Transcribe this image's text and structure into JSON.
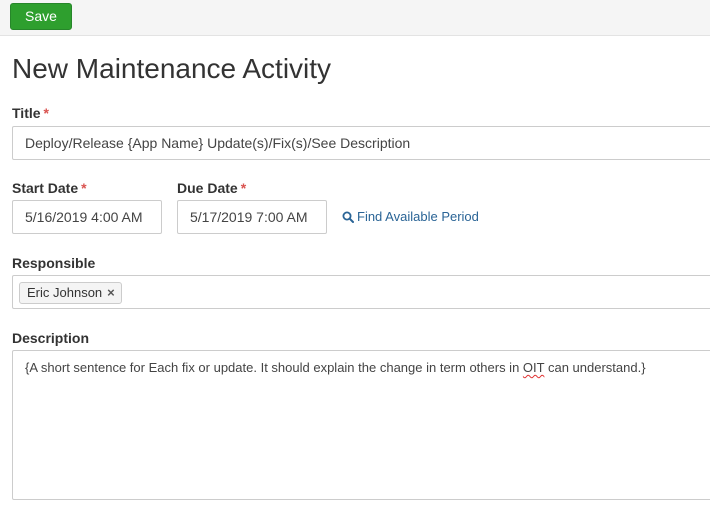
{
  "toolbar": {
    "save_label": "Save"
  },
  "page": {
    "title": "New Maintenance Activity"
  },
  "form": {
    "title": {
      "label": "Title",
      "required_mark": "*",
      "value": "Deploy/Release {App Name} Update(s)/Fix(s)/See Description"
    },
    "start_date": {
      "label": "Start Date",
      "required_mark": "*",
      "value": "5/16/2019 4:00 AM"
    },
    "due_date": {
      "label": "Due Date",
      "required_mark": "*",
      "value": "5/17/2019 7:00 AM"
    },
    "find_period": {
      "label": "Find Available Period",
      "icon": "search-icon"
    },
    "responsible": {
      "label": "Responsible",
      "tags": [
        {
          "name": "Eric Johnson",
          "remove_glyph": "×"
        }
      ]
    },
    "description": {
      "label": "Description",
      "value_before": "{A short sentence for Each fix or update. It should explain the change in term others in ",
      "value_flagged": "OIT",
      "value_after": " can understand.}"
    }
  },
  "colors": {
    "save_button": "#2e9f2e",
    "required": "#d9534f",
    "link": "#2a6496",
    "spellcheck": "#e03030"
  }
}
